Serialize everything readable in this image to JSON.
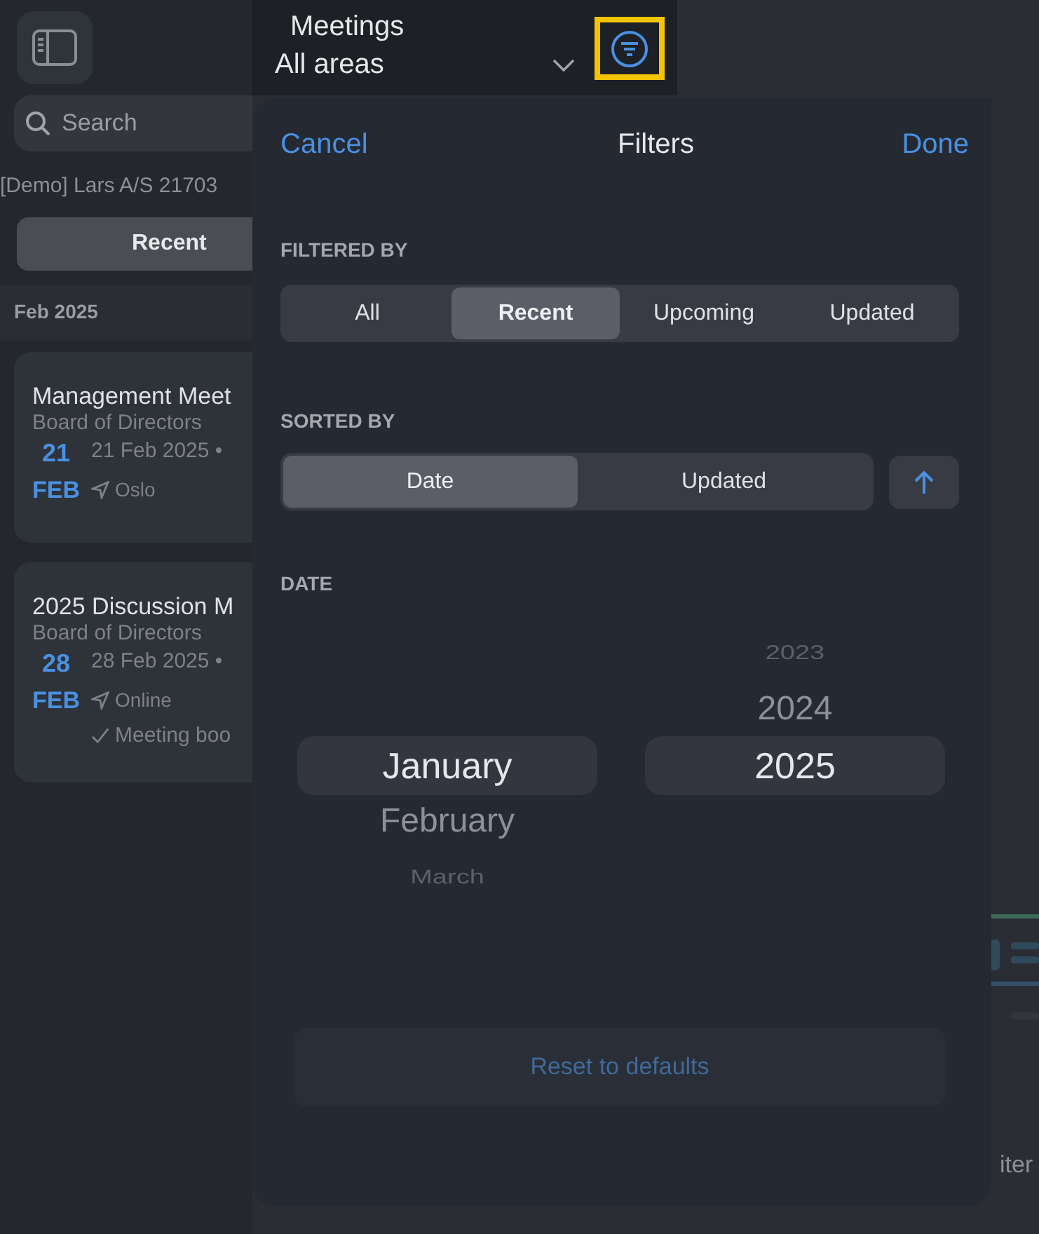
{
  "header": {
    "title": "Meetings",
    "subtitle": "All areas"
  },
  "sidebar": {
    "search": {
      "placeholder": "Search"
    },
    "account": "[Demo] Lars A/S 21703",
    "segment": "Recent",
    "section": "Feb 2025",
    "meetings": [
      {
        "title": "Management Meet",
        "group": "Board of Directors",
        "day": "21",
        "month": "FEB",
        "date": "21 Feb 2025 •",
        "location": "Oslo"
      },
      {
        "title": "2025 Discussion M",
        "group": "Board of Directors",
        "day": "28",
        "month": "FEB",
        "date": "28 Feb 2025 •",
        "location": "Online",
        "status": "Meeting boo"
      }
    ]
  },
  "background_text": "iter",
  "filters": {
    "cancel": "Cancel",
    "title": "Filters",
    "done": "Done",
    "filtered_by": {
      "label": "FILTERED BY",
      "options": [
        {
          "label": "All",
          "selected": false
        },
        {
          "label": "Recent",
          "selected": true
        },
        {
          "label": "Upcoming",
          "selected": false
        },
        {
          "label": "Updated",
          "selected": false
        }
      ]
    },
    "sorted_by": {
      "label": "SORTED BY",
      "options": [
        {
          "label": "Date",
          "selected": true
        },
        {
          "label": "Updated",
          "selected": false
        }
      ]
    },
    "date": {
      "label": "DATE",
      "months": [
        {
          "label": "January",
          "selected": true
        },
        {
          "label": "February",
          "selected": false
        },
        {
          "label": "March",
          "selected": false
        }
      ],
      "years": [
        {
          "label": "2023",
          "selected": false
        },
        {
          "label": "2024",
          "selected": false
        },
        {
          "label": "2025",
          "selected": true
        }
      ]
    },
    "reset": "Reset to defaults"
  }
}
